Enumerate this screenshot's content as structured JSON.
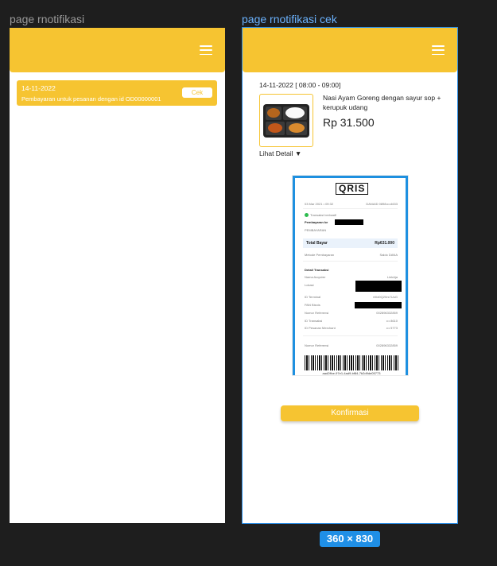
{
  "frames": {
    "left_title": "page rnotifikasi",
    "right_title": "page rnotifikasi cek",
    "dimension_badge": "360 × 830"
  },
  "notification": {
    "date": "14-11-2022",
    "message": "Pembayaran untuk pesanan dengan id OD00000001",
    "cek_label": "Cek"
  },
  "order": {
    "time": "14-11-2022 [ 08:00 - 09:00]",
    "item_name": "Nasi Ayam Goreng dengan sayur sop + kerupuk udang",
    "price": "Rp 31.500",
    "detail_link": "Lihat Detail ▼"
  },
  "receipt": {
    "logo": "QRIS",
    "date_line": "03 Mar 2021 • 09:32",
    "id_line": "DANAID 0898••••4633",
    "status": "Transaksi berhasil!",
    "pay_to_label": "Pembayaran ke",
    "category": "PEMBAYARAN",
    "total_label": "Total Bayar",
    "total_value": "Rp631.000",
    "method_label": "Metode Pembayaran",
    "method_value": "Saldo DANA",
    "detail_title": "Detail Transaksi",
    "acquirer_label": "Nama Acquirer",
    "acquirer_value": "LinkAja",
    "location_label": "Lokasi",
    "terminal_label": "ID Terminal",
    "terminal_value": "rWd0Q20rs7UuG",
    "pan_label": "PAN Bisnis",
    "ref_label": "Nomor Referensi",
    "ref_value": "002896332859",
    "trx_label": "ID Transaksi",
    "trx_value": "••• 8610",
    "merchant_label": "ID Pesanan Merchant",
    "merchant_value": "••• 5773",
    "ref2_label": "Nomor Referensi",
    "ref2_value": "002896332859",
    "barcode_text": "aad2ffce-97e1-4ad9-bf84-7b2d9de05773"
  },
  "confirm_label": "Konfirmasi",
  "colors": {
    "primary": "#f6c431",
    "accent": "#1f8fe6"
  }
}
